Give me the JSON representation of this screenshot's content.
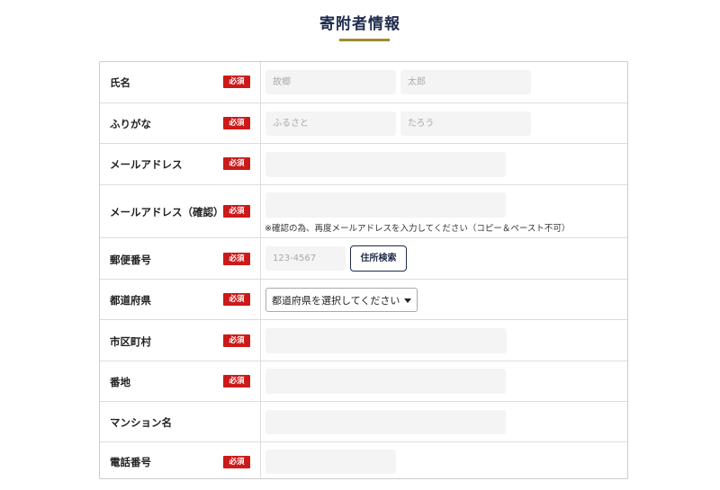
{
  "section_title": "寄附者情報",
  "required_label": "必須",
  "rows": {
    "name": {
      "label": "氏名",
      "last_placeholder": "故郷",
      "first_placeholder": "太郎"
    },
    "kana": {
      "label": "ふりがな",
      "last_placeholder": "ふるさと",
      "first_placeholder": "たろう"
    },
    "email": {
      "label": "メールアドレス"
    },
    "email_confirm": {
      "label": "メールアドレス（確認）",
      "note": "※確認の為、再度メールアドレスを入力してください（コピー＆ペースト不可）"
    },
    "postal": {
      "label": "郵便番号",
      "placeholder": "123-4567",
      "search_button": "住所検索"
    },
    "prefecture": {
      "label": "都道府県",
      "selected": "都道府県を選択してください"
    },
    "city": {
      "label": "市区町村"
    },
    "address": {
      "label": "番地"
    },
    "building": {
      "label": "マンション名"
    },
    "phone": {
      "label": "電話番号"
    }
  },
  "colors": {
    "navy": "#1f2b4d",
    "gold": "#a08a2e",
    "required_red": "#cc1a1a"
  }
}
